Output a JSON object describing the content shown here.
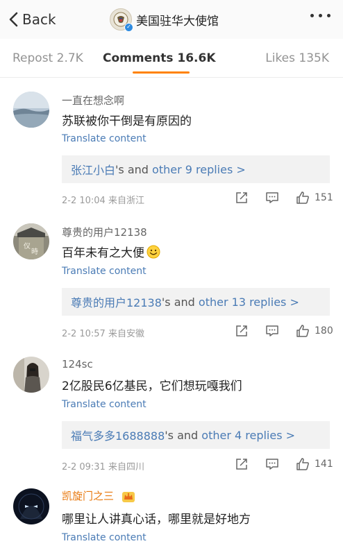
{
  "header": {
    "back_label": "Back",
    "title": "美国驻华大使馆",
    "icons": {
      "back": "chevron-left-icon",
      "more": "more-dots-icon",
      "verified": "verified-badge-icon"
    }
  },
  "tabs": {
    "repost": "Repost 2.7K",
    "comments": "Comments 16.6K",
    "likes": "Likes 135K",
    "active": "comments",
    "accent_color": "#ff8200"
  },
  "comments": [
    {
      "username": "一直在想念啊",
      "text": "苏联被你干倒是有原因的",
      "translate": "Translate content",
      "replies": {
        "user": "张江小白",
        "mid": "'s and ",
        "more": "other 9 replies >"
      },
      "time": "2-2 10:04",
      "source": "来自浙江",
      "likes": "151"
    },
    {
      "username": "尊贵的用户12138",
      "text": "百年未有之大便",
      "emoji": "smile-emoji-icon",
      "translate": "Translate content",
      "replies": {
        "user": "尊贵的用户12138",
        "mid": "'s and ",
        "more": "other 13 replies >"
      },
      "time": "2-2 10:57",
      "source": "来自安徽",
      "likes": "180"
    },
    {
      "username": "124sc",
      "text": "2亿股民6亿基民，它们想玩嘎我们",
      "translate": "Translate content",
      "replies": {
        "user": "福气多多1688888",
        "mid": "'s and ",
        "more": "other 4 replies >"
      },
      "time": "2-2 09:31",
      "source": "来自四川",
      "likes": "141"
    },
    {
      "username": "凯旋门之三",
      "badge": "crown-badge-icon",
      "text": "哪里让人讲真心话，哪里就是好地方",
      "translate": "Translate content"
    }
  ],
  "colors": {
    "link": "#4a7bb5",
    "muted": "#9a9a9a",
    "vip_name": "#e8780d"
  }
}
